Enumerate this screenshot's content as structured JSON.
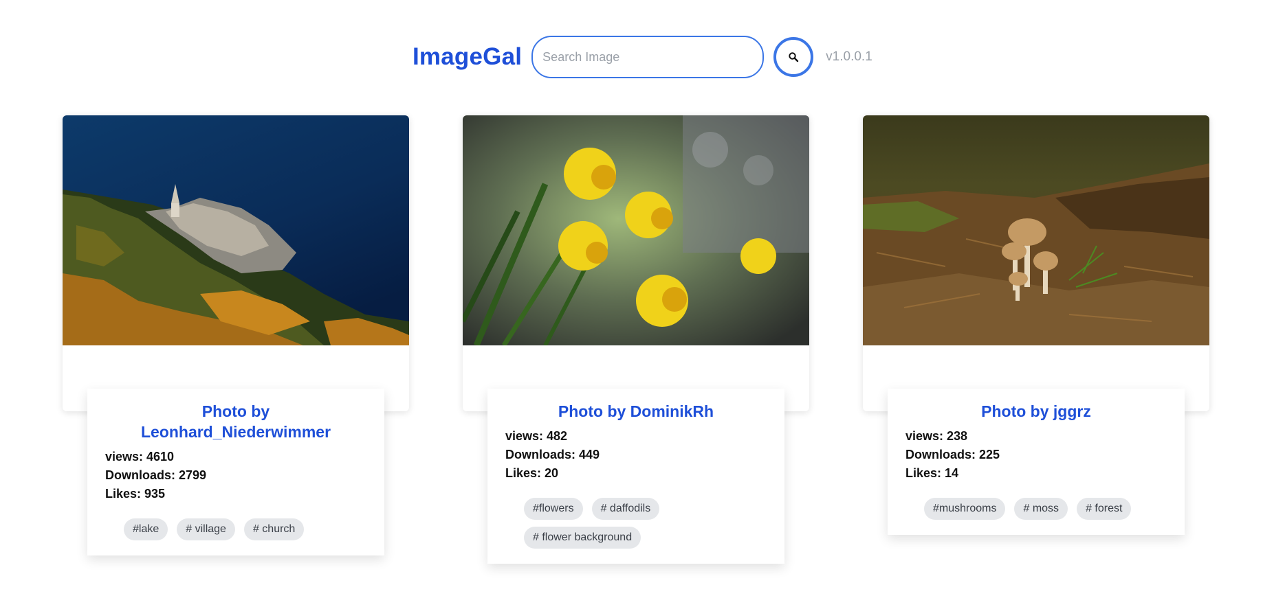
{
  "header": {
    "brand": "ImageGal",
    "search_placeholder": "Search Image",
    "search_value": "",
    "version": "v1.0.0.1",
    "accent_color": "#1e4fd8"
  },
  "cards": [
    {
      "title": "Photo by Leonhard_Niederwimmer",
      "views": "views: 4610",
      "downloads": "Downloads: 2799",
      "likes": "Likes: 935",
      "tags": [
        "#lake",
        "# village",
        "# church"
      ]
    },
    {
      "title": "Photo by DominikRh",
      "views": "views: 482",
      "downloads": "Downloads: 449",
      "likes": "Likes: 20",
      "tags": [
        "#flowers",
        "# daffodils",
        "# flower background"
      ]
    },
    {
      "title": "Photo by jggrz",
      "views": "views: 238",
      "downloads": "Downloads: 225",
      "likes": "Likes: 14",
      "tags": [
        "#mushrooms",
        "# moss",
        "# forest"
      ]
    }
  ]
}
